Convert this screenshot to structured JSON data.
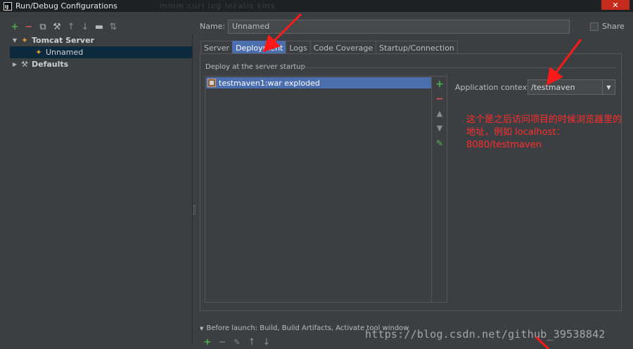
{
  "window": {
    "title": "Run/Debug Configurations",
    "app_icon": "IJ",
    "close_glyph": "✕",
    "ghost_title": "mmm  curl  log  localis  kms"
  },
  "left_toolbar": [
    {
      "name": "add-icon",
      "glyph": "+"
    },
    {
      "name": "remove-icon",
      "glyph": "−"
    },
    {
      "name": "copy-icon",
      "glyph": "⧉"
    },
    {
      "name": "wrench-icon",
      "glyph": "⚒"
    },
    {
      "name": "move-up-icon",
      "glyph": "↑"
    },
    {
      "name": "move-down-icon",
      "glyph": "↓"
    },
    {
      "name": "folder-icon",
      "glyph": "▬"
    },
    {
      "name": "sort-icon",
      "glyph": "⇅"
    }
  ],
  "tree": {
    "tomcat_server": "Tomcat Server",
    "unnamed": "Unnamed",
    "defaults": "Defaults"
  },
  "name_field": {
    "label": "Name:",
    "value": "Unnamed"
  },
  "share": {
    "label": "Share",
    "checked": false
  },
  "tabs": [
    "Server",
    "Deployment",
    "Logs",
    "Code Coverage",
    "Startup/Connection"
  ],
  "active_tab": "Deployment",
  "deployment": {
    "group_title": "Deploy at the server startup",
    "artifacts": [
      "testmaven1:war exploded"
    ],
    "app_context_label": "Application context:",
    "app_context_value": "/testmaven"
  },
  "annotation_note": "这个是之后访问项目的时候浏览器里的地址，例如 localhost：8080/testmaven",
  "before_launch": "Before launch: Build, Build Artifacts, Activate tool window",
  "watermark": "https://blog.csdn.net/github_39538842",
  "colors": {
    "accent": "#4b6eaf",
    "annotation": "#ff2d2d",
    "background": "#3c3f41"
  }
}
